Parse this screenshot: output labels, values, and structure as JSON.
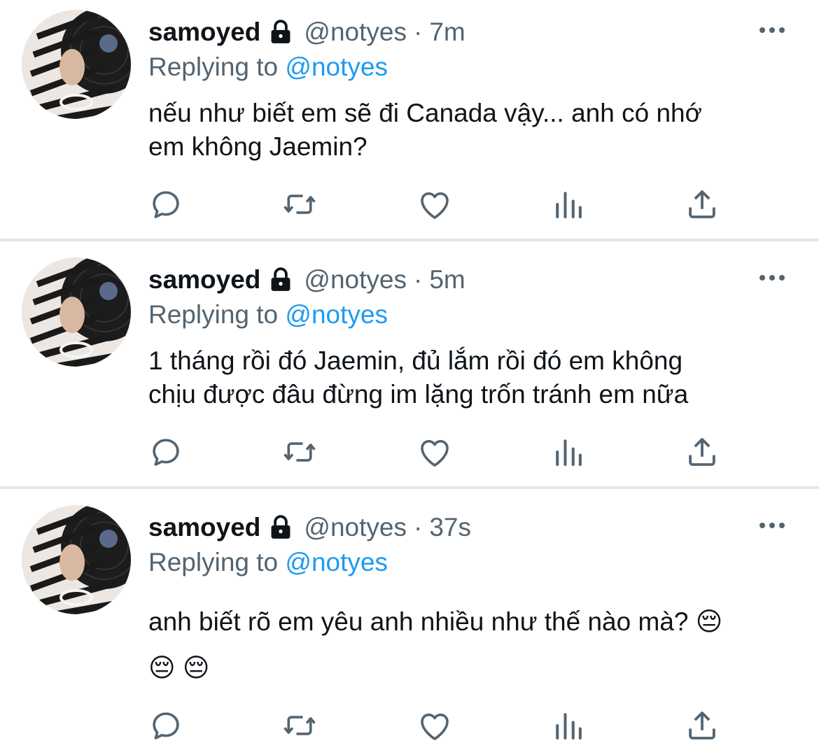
{
  "colors": {
    "text": "#0f1419",
    "secondary": "#536471",
    "link": "#1d9bf0",
    "divider": "#e6e6e6"
  },
  "tweets": [
    {
      "name": "samoyed",
      "handle": "@notyes",
      "separator": "·",
      "time": "7m",
      "replying_prefix": "Replying to",
      "replying_to": "@notyes",
      "lines": [
        "nếu như biết em sẽ đi Canada vậy... anh có nhớ",
        "em không Jaemin?"
      ]
    },
    {
      "name": "samoyed",
      "handle": "@notyes",
      "separator": "·",
      "time": "5m",
      "replying_prefix": "Replying to",
      "replying_to": "@notyes",
      "lines": [
        "1 tháng rồi đó Jaemin, đủ lắm rồi đó em không",
        "chịu được đâu đừng im lặng trốn tránh em nữa"
      ]
    },
    {
      "name": "samoyed",
      "handle": "@notyes",
      "separator": "·",
      "time": "37s",
      "replying_prefix": "Replying to",
      "replying_to": "@notyes",
      "lines": [
        "anh biết rõ em yêu anh nhiều như thế nào mà? 😔",
        "😔 😔"
      ]
    }
  ],
  "icons": [
    "lock-icon",
    "more-icon",
    "reply-icon",
    "retweet-icon",
    "like-icon",
    "analytics-icon",
    "share-icon"
  ]
}
